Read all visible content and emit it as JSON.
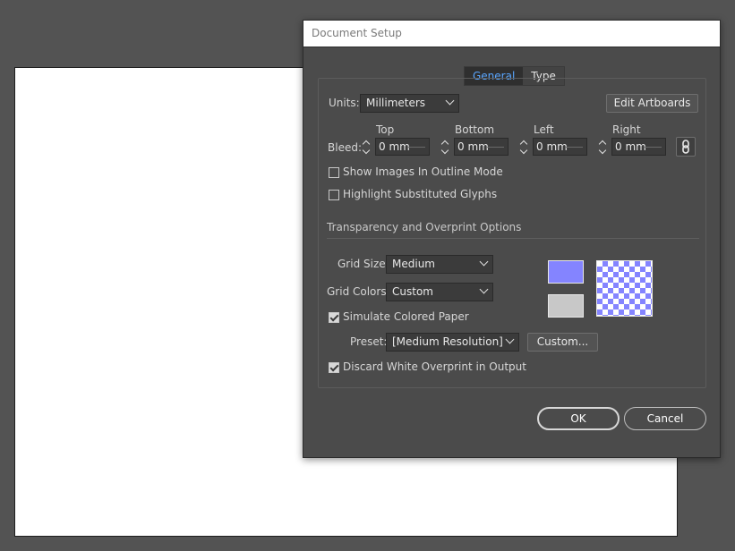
{
  "dialog": {
    "title": "Document Setup",
    "tabs": [
      {
        "label": "General",
        "active": true
      },
      {
        "label": "Type",
        "active": false
      }
    ]
  },
  "general": {
    "units_label": "Units:",
    "units_value": "Millimeters",
    "edit_artboards_label": "Edit Artboards",
    "bleed_label": "Bleed:",
    "bleed": [
      {
        "heading": "Top",
        "value": "0 mm"
      },
      {
        "heading": "Bottom",
        "value": "0 mm"
      },
      {
        "heading": "Left",
        "value": "0 mm"
      },
      {
        "heading": "Right",
        "value": "0 mm"
      }
    ],
    "show_images_outline": {
      "label": "Show Images In Outline Mode",
      "checked": false
    },
    "highlight_glyphs": {
      "label": "Highlight Substituted Glyphs",
      "checked": false
    }
  },
  "transparency": {
    "section_title": "Transparency and Overprint Options",
    "grid_size_label": "Grid Size:",
    "grid_size_value": "Medium",
    "grid_colors_label": "Grid Colors:",
    "grid_colors_value": "Custom",
    "simulate_paper": {
      "label": "Simulate Colored Paper",
      "checked": true
    },
    "preset_label": "Preset:",
    "preset_value": "[Medium Resolution]",
    "custom_button": "Custom...",
    "discard_overprint": {
      "label": "Discard White Overprint in Output",
      "checked": true
    },
    "colors": {
      "grid_color_1": "#8484ff",
      "grid_color_2": "#c8c8c8"
    }
  },
  "footer": {
    "ok_label": "OK",
    "cancel_label": "Cancel"
  },
  "icons": {
    "link_bleed": "chain-link-icon"
  }
}
